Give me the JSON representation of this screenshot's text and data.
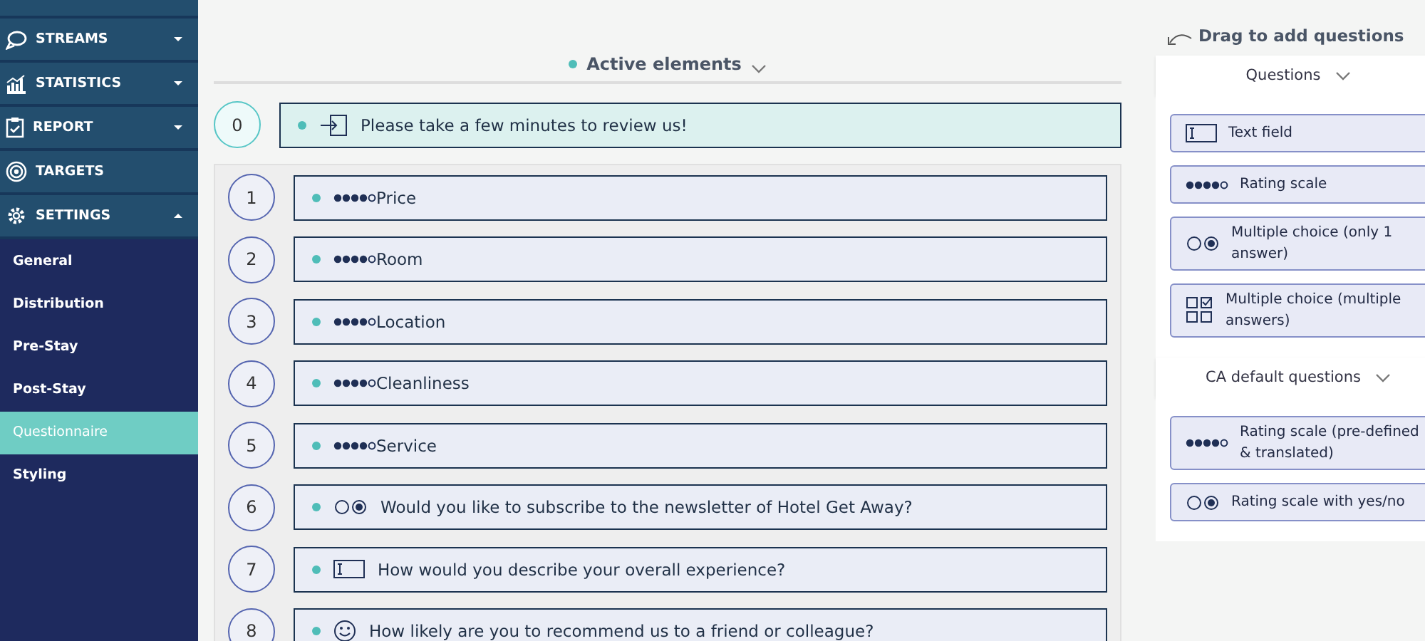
{
  "sidebar": {
    "items": [
      {
        "label": "STREAMS",
        "kind": "chat",
        "expanded": false
      },
      {
        "label": "STATISTICS",
        "kind": "chart",
        "expanded": false
      },
      {
        "label": "REPORT",
        "kind": "clipboard",
        "expanded": false
      },
      {
        "label": "TARGETS",
        "kind": "target"
      },
      {
        "label": "SETTINGS",
        "kind": "gear",
        "expanded": true,
        "children": [
          {
            "label": "General",
            "selected": false
          },
          {
            "label": "Distribution",
            "selected": false
          },
          {
            "label": "Pre-Stay",
            "selected": false
          },
          {
            "label": "Post-Stay",
            "selected": false
          },
          {
            "label": "Questionnaire",
            "selected": true
          },
          {
            "label": "Styling",
            "selected": false
          }
        ]
      }
    ]
  },
  "active_elements": {
    "title": "Active elements",
    "intro": {
      "number": "0",
      "kind": "enter",
      "text": "Please take a few minutes to review us!"
    },
    "questions": [
      {
        "number": "1",
        "kind": "rating",
        "text": "Price"
      },
      {
        "number": "2",
        "kind": "rating",
        "text": "Room"
      },
      {
        "number": "3",
        "kind": "rating",
        "text": "Location"
      },
      {
        "number": "4",
        "kind": "rating",
        "text": "Cleanliness"
      },
      {
        "number": "5",
        "kind": "rating",
        "text": "Service"
      },
      {
        "number": "6",
        "kind": "choice",
        "text": "Would you like to subscribe to the newsletter of Hotel Get Away?"
      },
      {
        "number": "7",
        "kind": "textfield",
        "text": "How would you describe your overall experience?"
      },
      {
        "number": "8",
        "kind": "smiley",
        "text": "How likely are you to recommend us to a friend or colleague?"
      }
    ]
  },
  "palette": {
    "title": "Drag to add questions",
    "sections": [
      {
        "title": "Questions",
        "items": [
          {
            "kind": "textfield",
            "label": "Text field"
          },
          {
            "kind": "rating",
            "label": "Rating scale"
          },
          {
            "kind": "choice",
            "label": "Multiple choice (only 1 answer)"
          },
          {
            "kind": "checkboxes",
            "label": "Multiple choice (multiple answers)"
          }
        ]
      },
      {
        "title": "CA default questions",
        "items": [
          {
            "kind": "rating",
            "label": "Rating scale (pre-defined & translated)"
          },
          {
            "kind": "choice",
            "label": "Rating scale with yes/no"
          }
        ]
      }
    ]
  }
}
